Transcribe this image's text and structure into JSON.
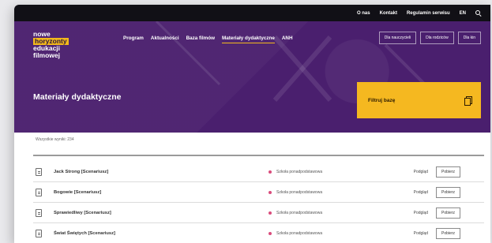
{
  "topbar": {
    "links": [
      "O nas",
      "Kontakt",
      "Regulamin serwisu",
      "EN"
    ]
  },
  "logo": {
    "lines": [
      "nowe",
      "horyzonty",
      "edukacji",
      "filmowej"
    ]
  },
  "nav": {
    "items": [
      "Program",
      "Aktualności",
      "Baza filmów",
      "Materiały dydaktyczne",
      "ANH"
    ],
    "active_index": 3
  },
  "audience": [
    "Dla nauczycieli",
    "Dla rodziców",
    "Dla kin"
  ],
  "page": {
    "title": "Materiały dydaktyczne",
    "filter_label": "Filtruj bazę",
    "count_label": "Wszystkie wyniki: 234"
  },
  "rows": [
    {
      "title": "Jack Strong [Scenariusz]",
      "school": "Szkoła ponadpodstawowa",
      "preview": "Podgląd",
      "download": "Pobierz"
    },
    {
      "title": "Bogowie [Scenariusz]",
      "school": "Szkoła ponadpodstawowa",
      "preview": "Podgląd",
      "download": "Pobierz"
    },
    {
      "title": "Sprawiedliwy [Scenariusz]",
      "school": "Szkoła ponadpodstawowa",
      "preview": "Podgląd",
      "download": "Pobierz"
    },
    {
      "title": "Świat Świętych [Scenariusz]",
      "school": "Szkoła ponadpodstawowa",
      "preview": "Podgląd",
      "download": "Pobierz"
    }
  ],
  "colors": {
    "header": "#4a1f6e",
    "accent": "#f5b820",
    "topbar": "#111016",
    "school_dot": "#d94c7c"
  }
}
